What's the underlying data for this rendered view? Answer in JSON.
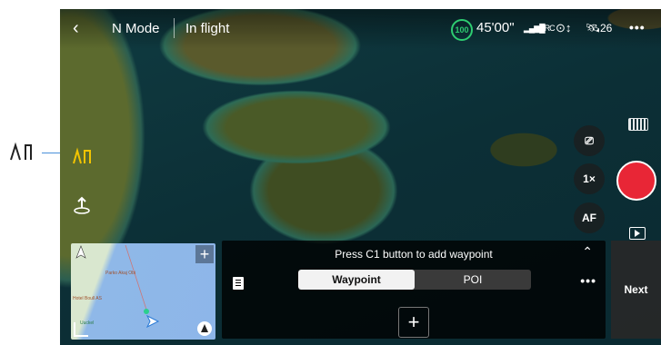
{
  "topbar": {
    "back_icon": "back-chevron-icon",
    "mode": "N Mode",
    "status": "In flight",
    "battery_percent": "100",
    "flight_time": "45'00\"",
    "signal_label": "RC",
    "satellite_count": "26",
    "more_icon": "more-icon"
  },
  "left_tools": {
    "route_icon": "waypoint-route-icon",
    "altitude_icon": "takeoff-altitude-icon",
    "callout_icon": "waypoint-route-icon"
  },
  "right_controls": {
    "camera_switch_icon": "camera-switch-icon",
    "zoom": "1×",
    "af": "AF",
    "film_icon": "film-icon",
    "record_icon": "record-icon",
    "playback_icon": "playback-icon"
  },
  "minimap": {
    "labels": [
      "Parko Akaj Obi",
      "Hotel Boull AS",
      "Uuckel"
    ],
    "compass_icon": "compass-icon",
    "expand_label": "+"
  },
  "waypoint_panel": {
    "hint": "Press C1 button to add waypoint",
    "tabs": [
      {
        "label": "Waypoint",
        "selected": true
      },
      {
        "label": "POI",
        "selected": false
      }
    ],
    "add_label": "+",
    "list_icon": "list-icon"
  },
  "next_label": "Next",
  "colors": {
    "battery": "#2ecc71",
    "record": "#e82636",
    "route_highlight": "#f2c400"
  }
}
